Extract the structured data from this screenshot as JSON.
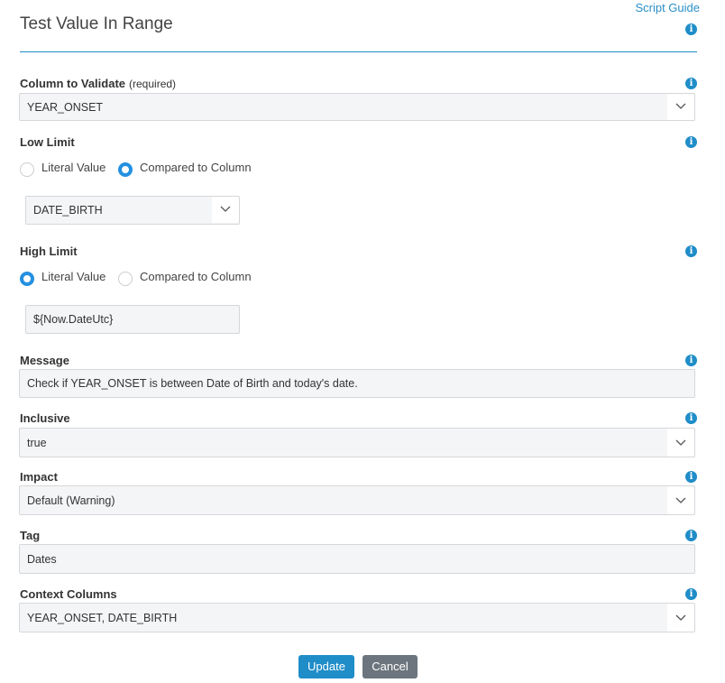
{
  "header": {
    "title": "Test Value In Range",
    "script_guide_link": "Script Guide",
    "info_glyph": "i"
  },
  "colors": {
    "accent": "#1f8dc8",
    "cancel": "#6c757d",
    "field_bg": "#f4f5f7"
  },
  "form": {
    "column_to_validate": {
      "label": "Column to Validate",
      "required_note": "(required)",
      "value": "YEAR_ONSET"
    },
    "low_limit": {
      "label": "Low Limit",
      "options": [
        {
          "label": "Literal Value",
          "selected": false
        },
        {
          "label": "Compared to Column",
          "selected": true
        }
      ],
      "value": "DATE_BIRTH"
    },
    "high_limit": {
      "label": "High Limit",
      "options": [
        {
          "label": "Literal Value",
          "selected": true
        },
        {
          "label": "Compared to Column",
          "selected": false
        }
      ],
      "value": "${Now.DateUtc}"
    },
    "message": {
      "label": "Message",
      "value": "Check if YEAR_ONSET is between Date of Birth and today's date."
    },
    "inclusive": {
      "label": "Inclusive",
      "value": "true"
    },
    "impact": {
      "label": "Impact",
      "value": "Default (Warning)"
    },
    "tag": {
      "label": "Tag",
      "value": "Dates"
    },
    "context_columns": {
      "label": "Context Columns",
      "value": "YEAR_ONSET, DATE_BIRTH"
    }
  },
  "actions": {
    "update_label": "Update",
    "cancel_label": "Cancel"
  }
}
